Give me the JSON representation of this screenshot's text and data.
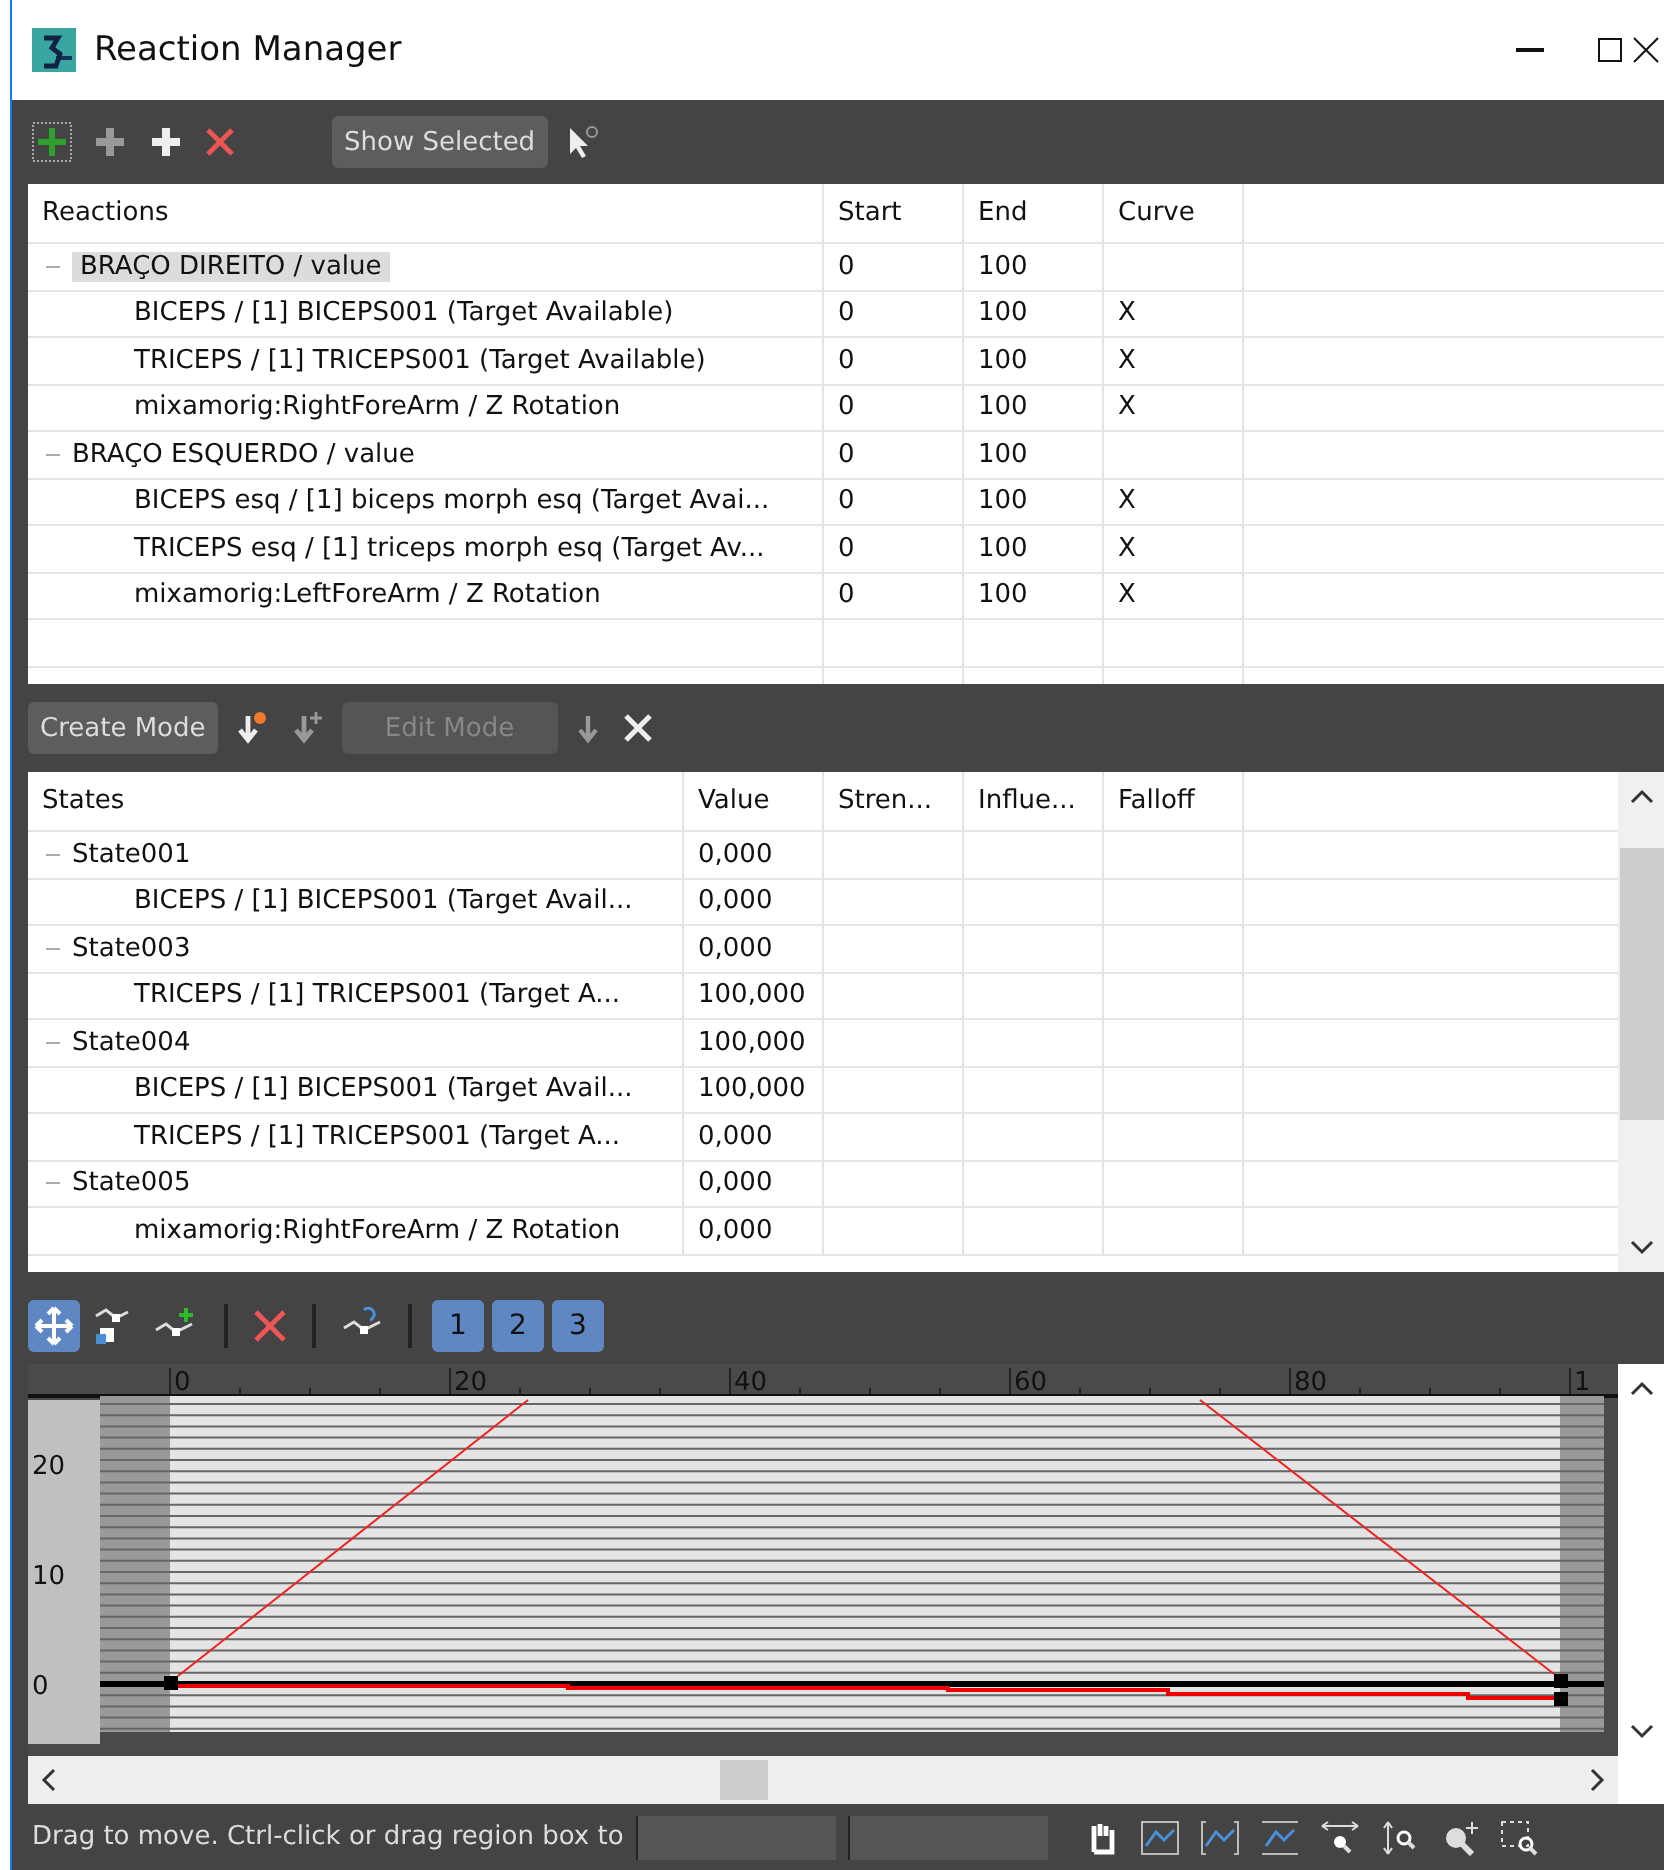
{
  "window": {
    "title": "Reaction Manager"
  },
  "reaction_toolbar": {
    "show_selected": "Show Selected"
  },
  "reactions": {
    "columns": [
      "Reactions",
      "Start",
      "End",
      "Curve"
    ],
    "rows": [
      {
        "label": "BRAÇO DIREITO / value",
        "start": "0",
        "end": "100",
        "selected": true,
        "children": [
          {
            "label": "BICEPS / [1] BICEPS001  (Target Available)",
            "start": "0",
            "end": "100",
            "curve": "X",
            "selected": false
          },
          {
            "label": "TRICEPS / [1] TRICEPS001  (Target Available)",
            "start": "0",
            "end": "100",
            "curve": "X",
            "selected": false
          },
          {
            "label": "mixamorig:RightForeArm / Z Rotation",
            "start": "0",
            "end": "100",
            "curve": "X",
            "selected": false
          }
        ]
      },
      {
        "label": "BRAÇO ESQUERDO / value",
        "start": "0",
        "end": "100",
        "selected": false,
        "children": [
          {
            "label": "BICEPS esq / [1] biceps morph esq  (Target Avai...",
            "start": "0",
            "end": "100",
            "curve": "X",
            "selected": false
          },
          {
            "label": "TRICEPS esq / [1] triceps morph esq  (Target Av...",
            "start": "0",
            "end": "100",
            "curve": "X",
            "selected": false
          },
          {
            "label": "mixamorig:LeftForeArm / Z Rotation",
            "start": "0",
            "end": "100",
            "curve": "X",
            "selected": false
          }
        ]
      }
    ]
  },
  "state_toolbar": {
    "create_mode": "Create Mode",
    "edit_mode": {
      "label": "Edit Mode",
      "disabled": true
    }
  },
  "states": {
    "columns": [
      "States",
      "Value",
      "Stren...",
      "Influe...",
      "Falloff"
    ],
    "rows": [
      {
        "label": "State001",
        "value": "0,000",
        "children": [
          {
            "label": "BICEPS / [1] BICEPS001  (Target Avail...",
            "value": "0,000"
          }
        ]
      },
      {
        "label": "State003",
        "value": "0,000",
        "children": [
          {
            "label": "TRICEPS / [1] TRICEPS001  (Target A...",
            "value": "100,000"
          }
        ]
      },
      {
        "label": "State004",
        "value": "100,000",
        "children": [
          {
            "label": "BICEPS / [1] BICEPS001  (Target Avail...",
            "value": "100,000"
          },
          {
            "label": "TRICEPS / [1] TRICEPS001  (Target A...",
            "value": "0,000"
          }
        ]
      },
      {
        "label": "State005",
        "value": "0,000",
        "children": [
          {
            "label": "mixamorig:RightForeArm / Z Rotation",
            "value": "0,000"
          }
        ]
      }
    ]
  },
  "curve_toolbar": {
    "layers": [
      {
        "label": "1",
        "on": true
      },
      {
        "label": "2",
        "on": true
      },
      {
        "label": "3",
        "on": true
      }
    ]
  },
  "graph": {
    "x_ticks": [
      "0",
      "20",
      "40",
      "60",
      "80",
      "1"
    ],
    "y_ticks": [
      "20",
      "10",
      "0"
    ]
  },
  "status_bar": {
    "prompt": "Drag to move. Ctrl-click or drag region box to"
  }
}
